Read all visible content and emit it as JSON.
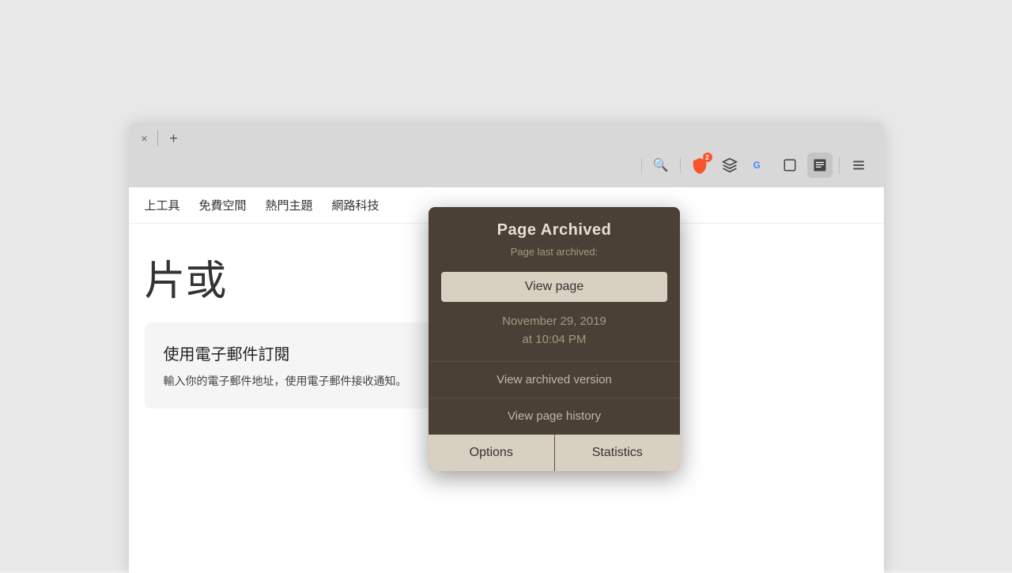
{
  "browser": {
    "tab_close_label": "×",
    "tab_new_label": "+",
    "toolbar": {
      "search_icon": "🔍",
      "shield_badge": "2",
      "layers_icon": "⊕",
      "translate_icon": "G",
      "window_icon": "☐",
      "wayback_icon": "🗑",
      "menu_icon": "☰"
    }
  },
  "nav": {
    "items": [
      "上工具",
      "免費空間",
      "熱門主題",
      "網路科技"
    ]
  },
  "page": {
    "big_text": "片或",
    "section_title": "使用電子郵件訂閱",
    "section_text": "輸入你的電子郵件地址，使用電子郵件接收通知。"
  },
  "popup": {
    "title": "Page Archived",
    "subtitle": "Page last archived:",
    "view_page_label": "View page",
    "date_line1": "November 29, 2019",
    "date_line2": "at 10:04 PM",
    "view_archived_label": "View archived version",
    "view_history_label": "View page history",
    "options_label": "Options",
    "statistics_label": "Statistics"
  }
}
